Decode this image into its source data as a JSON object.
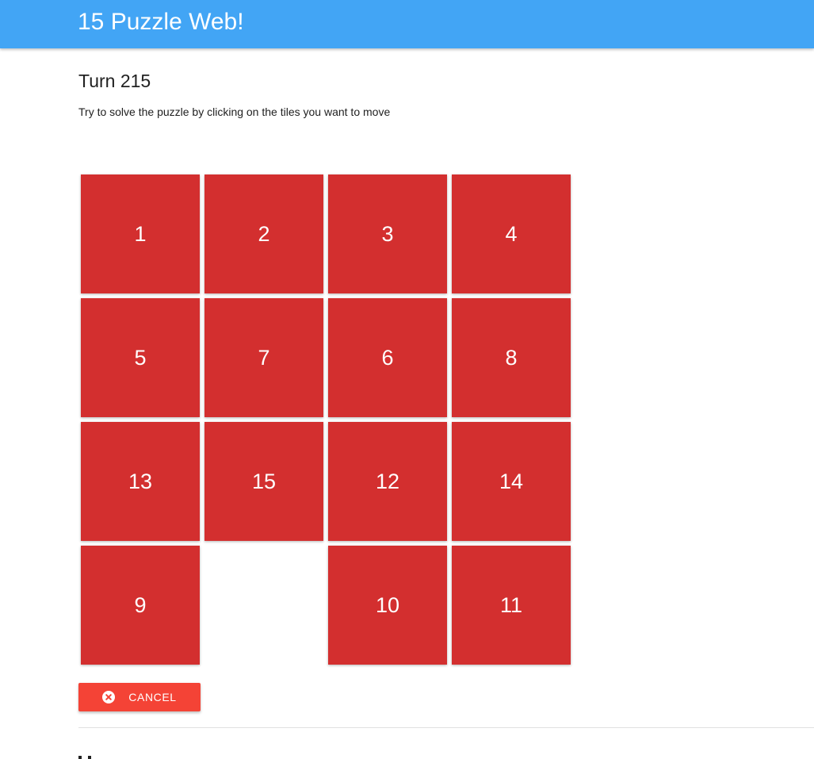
{
  "app": {
    "title": "15 Puzzle Web!",
    "accent_color": "#42a5f5"
  },
  "game": {
    "turn_label": "Turn 215",
    "instructions": "Try to solve the puzzle by clicking on the tiles you want to move",
    "tile_color": "#d32f2f",
    "tiles": [
      {
        "label": "1"
      },
      {
        "label": "2"
      },
      {
        "label": "3"
      },
      {
        "label": "4"
      },
      {
        "label": "5"
      },
      {
        "label": "7"
      },
      {
        "label": "6"
      },
      {
        "label": "8"
      },
      {
        "label": "13"
      },
      {
        "label": "15"
      },
      {
        "label": "12"
      },
      {
        "label": "14"
      },
      {
        "label": "9"
      },
      {
        "label": ""
      },
      {
        "label": "10"
      },
      {
        "label": "11"
      }
    ]
  },
  "actions": {
    "cancel_label": "CANCEL",
    "cancel_icon": "cancel-circle-icon",
    "cancel_color": "#f44336"
  }
}
